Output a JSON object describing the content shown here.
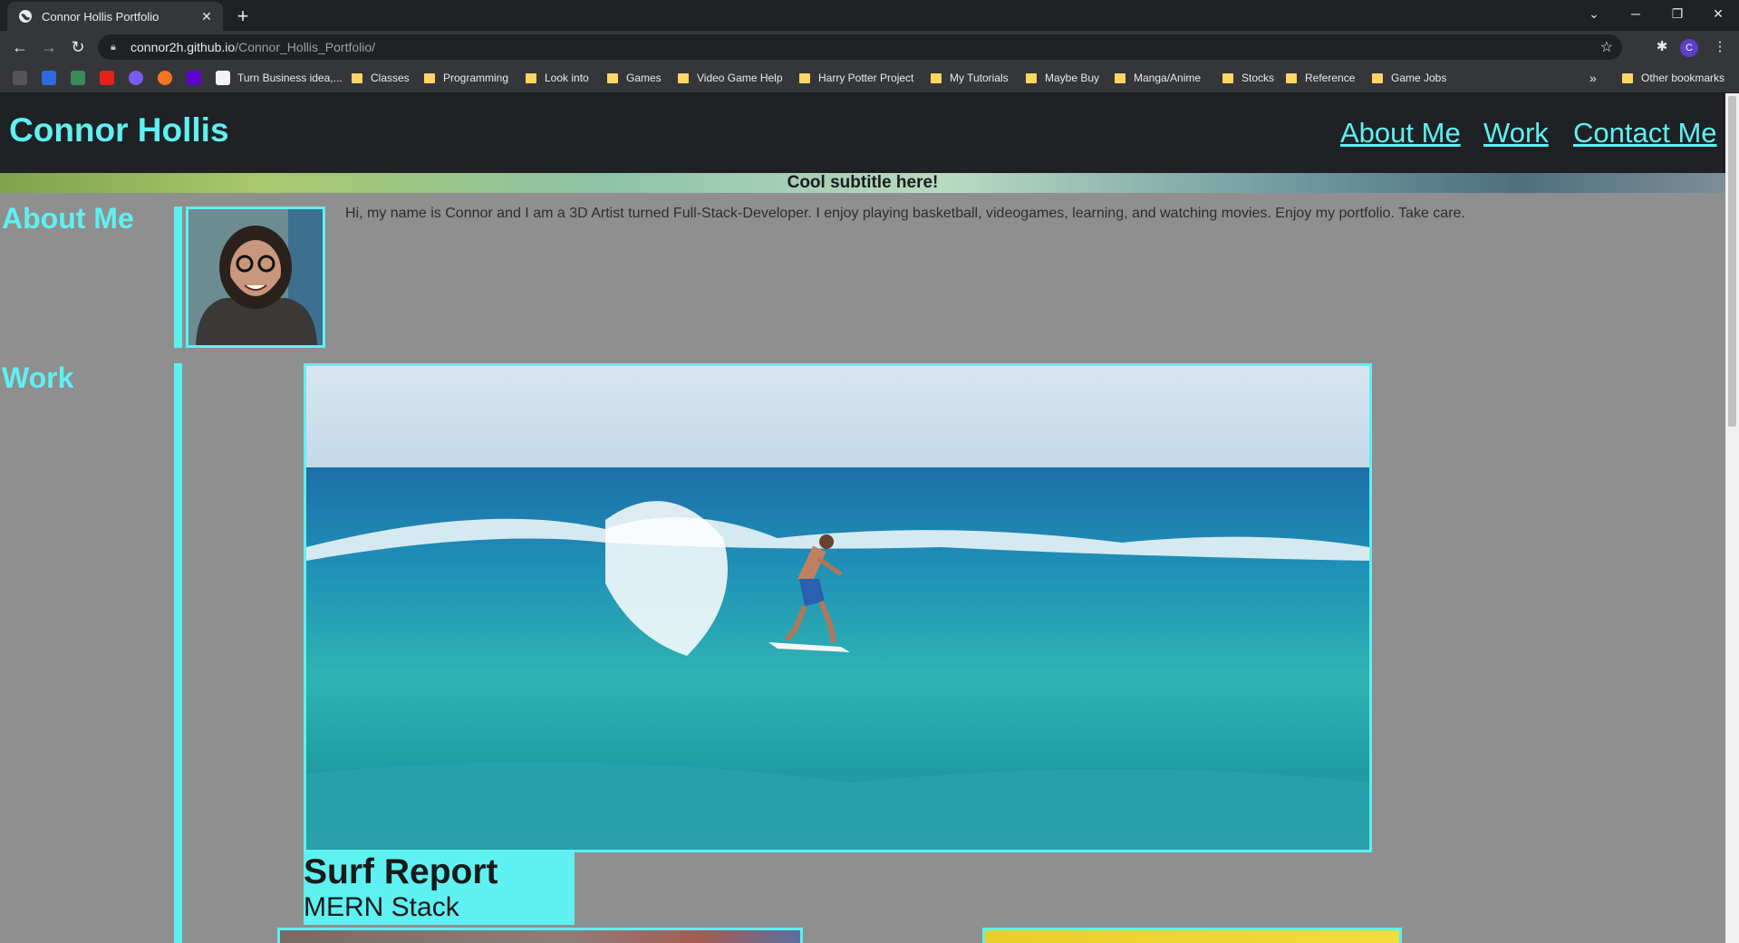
{
  "browser": {
    "tab_title": "Connor Hollis Portfolio",
    "url_host": "connor2h.github.io",
    "url_path": "/Connor_Hollis_Portfolio/",
    "profile_initial": "C",
    "bookmarks": [
      {
        "label": "Turn Business idea,...",
        "type": "page"
      },
      {
        "label": "Classes",
        "type": "folder"
      },
      {
        "label": "Programming",
        "type": "folder"
      },
      {
        "label": "Look into",
        "type": "folder"
      },
      {
        "label": "Games",
        "type": "folder"
      },
      {
        "label": "Video Game Help",
        "type": "folder"
      },
      {
        "label": "Harry Potter Project",
        "type": "folder"
      },
      {
        "label": "My Tutorials",
        "type": "folder"
      },
      {
        "label": "Maybe Buy",
        "type": "folder"
      },
      {
        "label": "Manga/Anime",
        "type": "folder"
      },
      {
        "label": "Stocks",
        "type": "folder"
      },
      {
        "label": "Reference",
        "type": "folder"
      },
      {
        "label": "Game Jobs",
        "type": "folder"
      }
    ],
    "more_bookmarks": "»",
    "other_bookmarks": "Other bookmarks"
  },
  "site": {
    "title": "Connor Hollis",
    "nav": [
      "About Me",
      "Work",
      "Contact Me"
    ],
    "subtitle": "Cool subtitle here!",
    "about": {
      "heading": "About Me",
      "text": "Hi, my name is Connor and I am a 3D Artist turned Full-Stack-Developer. I enjoy playing basketball, videogames, learning, and watching movies. Enjoy my portfolio. Take care."
    },
    "work": {
      "heading": "Work",
      "projects": [
        {
          "title": "Surf Report",
          "subtitle": "MERN Stack"
        }
      ]
    }
  },
  "colors": {
    "accent": "#5ff0f2",
    "header_bg": "#1f2125",
    "page_bg": "#8f8f8f"
  }
}
